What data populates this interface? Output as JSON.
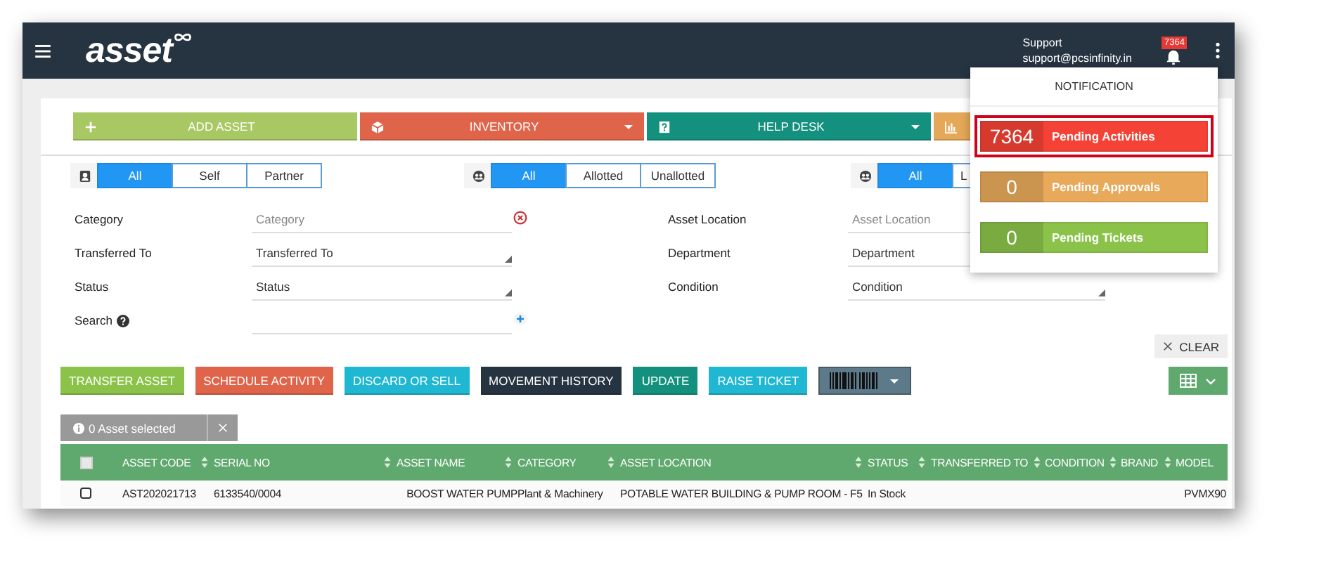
{
  "header": {
    "logo": "asset",
    "user_name": "Support",
    "user_email": "support@pcsinfinity.in",
    "notification_count": "7364"
  },
  "toolbar": [
    {
      "label": "ADD ASSET",
      "color": "#a8c863",
      "dropdown": false
    },
    {
      "label": "INVENTORY",
      "color": "#e0644a",
      "dropdown": true
    },
    {
      "label": "HELP DESK",
      "color": "#14907e",
      "dropdown": true
    },
    {
      "color": "#e4a858",
      "dropdown": false
    }
  ],
  "filter_groups": [
    {
      "options": [
        {
          "label": "All",
          "selected": true
        },
        {
          "label": "Self",
          "selected": false
        },
        {
          "label": "Partner",
          "selected": false
        }
      ]
    },
    {
      "options": [
        {
          "label": "All",
          "selected": true
        },
        {
          "label": "Allotted",
          "selected": false
        },
        {
          "label": "Unallotted",
          "selected": false
        }
      ]
    },
    {
      "options": [
        {
          "label": "All",
          "selected": true
        },
        {
          "label": "L",
          "selected": false
        }
      ]
    }
  ],
  "form_left": [
    {
      "label": "Category",
      "placeholder": "Category",
      "kind": "clearable"
    },
    {
      "label": "Transferred To",
      "value": "Transferred To",
      "kind": "select"
    },
    {
      "label": "Status",
      "value": "Status",
      "kind": "select"
    },
    {
      "label": "Search",
      "kind": "search"
    }
  ],
  "form_right": [
    {
      "label": "Asset Location",
      "placeholder": "Asset Location",
      "kind": "text"
    },
    {
      "label": "Department",
      "value": "Department",
      "kind": "select"
    },
    {
      "label": "Condition",
      "value": "Condition",
      "kind": "select"
    }
  ],
  "clear_button": "CLEAR",
  "actions": [
    {
      "label": "TRANSFER ASSET",
      "color": "#8bc34a"
    },
    {
      "label": "SCHEDULE ACTIVITY",
      "color": "#e0644a"
    },
    {
      "label": "DISCARD OR SELL",
      "color": "#1fb7d1"
    },
    {
      "label": "MOVEMENT HISTORY",
      "color": "#263340"
    },
    {
      "label": "UPDATE",
      "color": "#14907e"
    },
    {
      "label": "RAISE TICKET",
      "color": "#1fb7d1"
    }
  ],
  "selection": {
    "text": "0 Asset selected"
  },
  "table": {
    "all_checked": false,
    "columns": [
      {
        "label": "ASSET CODE",
        "sortable": true
      },
      {
        "label": "SERIAL NO",
        "sortable": true
      },
      {
        "label": "ASSET NAME",
        "sortable": true
      },
      {
        "label": "CATEGORY",
        "sortable": true
      },
      {
        "label": "ASSET LOCATION",
        "sortable": true
      },
      {
        "label": "STATUS",
        "sortable": true
      },
      {
        "label": "TRANSFERRED TO",
        "sortable": true
      },
      {
        "label": "CONDITION",
        "sortable": true
      },
      {
        "label": "BRAND",
        "sortable": true
      },
      {
        "label": "MODEL",
        "sortable": false
      }
    ],
    "rows": [
      {
        "checked": false,
        "cells": [
          "AST202021713",
          "6133540/0004",
          "BOOST WATER PUMP",
          "Plant & Machinery",
          "POTABLE WATER BUILDING & PUMP ROOM - F5",
          "In Stock",
          "",
          "",
          "",
          "PVMX90"
        ]
      }
    ]
  },
  "notification_popup": {
    "title": "NOTIFICATION",
    "items": [
      {
        "count": "7364",
        "label": "Pending Activities",
        "color": "#f44336",
        "selected": true
      },
      {
        "count": "0",
        "label": "Pending Approvals",
        "color": "#e8a95a",
        "selected": false
      },
      {
        "count": "0",
        "label": "Pending Tickets",
        "color": "#8bc34a",
        "selected": false
      }
    ]
  }
}
